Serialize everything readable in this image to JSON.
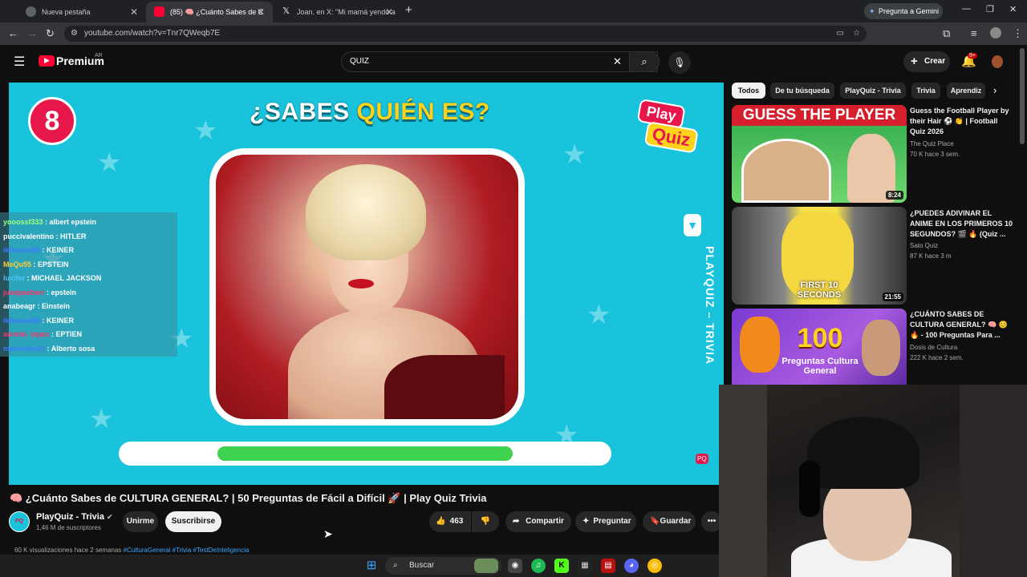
{
  "browser": {
    "tabs": [
      {
        "label": "Nueva pestaña",
        "active": false
      },
      {
        "label": "(85) 🧠 ¿Cuánto Sabes de C",
        "active": true
      },
      {
        "label": "Joan. en X: \"Mi mamá yendo a",
        "active": false
      }
    ],
    "new_tab_symbol": "+",
    "gemini_label": "Pregunta a Gemini",
    "url": "youtube.com/watch?v=Tnr7QWeqb7E"
  },
  "header": {
    "brand": "Premium",
    "region": "AR",
    "search_value": "QUIZ",
    "create_label": "Crear",
    "notif_count": "9+"
  },
  "video": {
    "question_number": "8",
    "title_part1": "¿SABES ",
    "title_part2": "QUIÉN ES?",
    "logo_top": "Play",
    "logo_bottom": "Quiz",
    "side_label": "PLAYQUIZ – TRIVIA",
    "progress_fraction": 0.6
  },
  "chat": [
    {
      "user": "yooossf333",
      "msg": " : albert epstein",
      "color": "#9dff7a"
    },
    {
      "user": "puccivalentino",
      "msg": " : HITLER",
      "color": "#ffffff"
    },
    {
      "user": "iklimasd85",
      "msg": " : KEINER",
      "color": "#3a7bff"
    },
    {
      "user": "MeQu55",
      "msg": " : EPSTEIN",
      "color": "#ffcc33"
    },
    {
      "user": "luxifer",
      "msg": " : MICHAEL JACKSON",
      "color": "#4fc3f7"
    },
    {
      "user": "juanpaeberr",
      "msg": " : epstein",
      "color": "#ff3366"
    },
    {
      "user": "anabeagr",
      "msg": " : Einstein",
      "color": "#ffffff"
    },
    {
      "user": "iklimasd85",
      "msg": " : KEINER",
      "color": "#3a7bff"
    },
    {
      "user": "aurelio_lopez",
      "msg": " : EPTIEN",
      "color": "#ff3366"
    },
    {
      "user": "mercedes23",
      "msg": " : Alberto sosa",
      "color": "#3a7bff"
    }
  ],
  "below": {
    "title": "🧠 ¿Cuánto Sabes de CULTURA GENERAL? | 50 Preguntas de Fácil a Difícil 🚀 | Play Quiz Trivia",
    "channel": "PlayQuiz - Trivia",
    "subs": "1,46 M de suscriptores",
    "join": "Unirme",
    "subscribe": "Suscribirse",
    "likes": "463",
    "share": "Compartir",
    "ask": "Preguntar",
    "save": "Guardar",
    "stats": "60 K visualizaciones  hace 2 semanas ",
    "tags": "#CulturaGeneral #Trivia #TestDeInteligencia"
  },
  "chips": [
    "Todos",
    "De tu búsqueda",
    "PlayQuiz - Trivia",
    "Trivia",
    "Aprendiz"
  ],
  "recs": [
    {
      "thumb_text": "GUESS THE PLAYER",
      "title": "Guess the Football Player by their Hair ⚽ 👏 | Football Quiz 2026",
      "channel": "The Quiz Place",
      "meta": "70 K  hace 3 sem.",
      "duration": "8:24"
    },
    {
      "thumb_text": "FIRST 10 SECONDS",
      "title": "¿PUEDES ADIVINAR EL ANIME EN LOS PRIMEROS 10 SEGUNDOS? 🎬 🔥 (Quiz ...",
      "channel": "Sato Quiz",
      "meta": "87 K  hace 3 m",
      "duration": "21:55"
    },
    {
      "thumb_text": "100",
      "thumb_sub": "Preguntas Cultura General",
      "title": "¿CUÁNTO SABES DE CULTURA GENERAL? 🧠 😊 🔥 - 100 Preguntas Para ...",
      "channel": "Dosis de Cultura",
      "meta": "222 K  hace 2 sem.",
      "duration": ""
    }
  ],
  "taskbar": {
    "search": "Buscar"
  },
  "colors": {
    "accent": "#19c3dc",
    "quiz_red": "#e8174b",
    "quiz_yellow": "#ffd21c",
    "progress": "#3fd24f"
  }
}
